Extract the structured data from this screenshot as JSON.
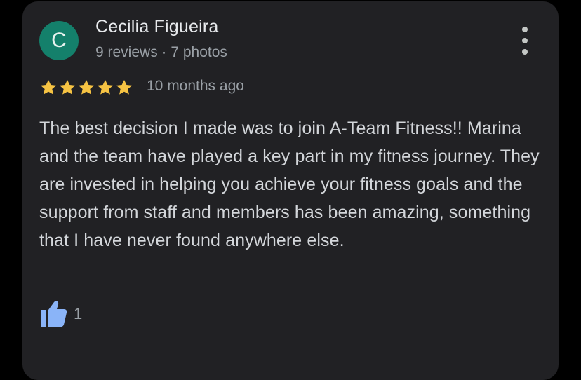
{
  "review": {
    "author": {
      "initial": "C",
      "name": "Cecilia Figueira",
      "stats": "9 reviews · 7 photos",
      "avatar_color": "#14806b"
    },
    "rating": 5,
    "rating_max": 5,
    "star_color": "#f6c343",
    "time": "10 months ago",
    "text": "The best decision I made was to join A-Team Fitness!! Marina and the team have played a key part in my fitness journey. They are invested in helping you achieve your fitness goals and the support from staff and members has been amazing, something that I have never found anywhere else.",
    "likes": "1",
    "like_color": "#8ab4f8"
  },
  "icons": {
    "more": "more-vert-icon",
    "star": "star-icon",
    "like": "thumbs-up-icon"
  }
}
